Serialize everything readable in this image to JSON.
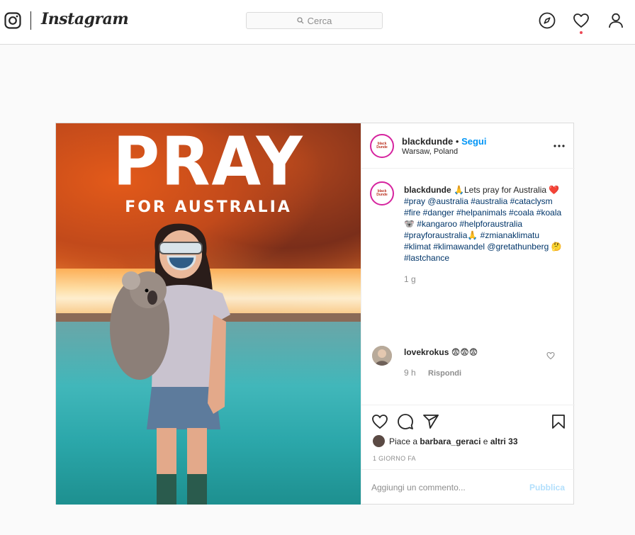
{
  "nav": {
    "brand": "Instagram",
    "search_placeholder": "Cerca",
    "icons": [
      "instagram-logo-icon",
      "search-icon",
      "explore-compass-icon",
      "activity-heart-icon",
      "profile-icon"
    ]
  },
  "post": {
    "image": {
      "headline": "PRAY",
      "subheadline": "FOR AUSTRALIA"
    },
    "header": {
      "username": "blackdunde",
      "separator": "•",
      "follow": "Segui",
      "location": "Warsaw, Poland",
      "avatar_text": "black Dunde"
    },
    "caption": {
      "username": "blackdunde",
      "emoji_pray": "🙏",
      "text_start": "Lets pray for Australia",
      "emoji_heart": "❤️",
      "tags": "#pray @australia #australia #cataclysm #fire #danger #helpanimals #coala #koala🐨 #kangaroo #helpforaustralia #prayforaustralia🙏 #zmianaklimatu #klimat #klimawandel @gretathunberg 🤔#lastchance",
      "time": "1 g"
    },
    "comment": {
      "username": "lovekrokus",
      "text": "😨😨😨",
      "time": "9 h",
      "reply": "Rispondi"
    },
    "likes": {
      "prefix": "Piace a ",
      "user": "barbara_geraci",
      "middle": " e ",
      "others": "altri 33"
    },
    "date": "1 GIORNO FA",
    "add_comment_placeholder": "Aggiungi un commento...",
    "publish": "Pubblica"
  },
  "colors": {
    "link": "#0095f6",
    "hashtag": "#003569",
    "border": "#dbdbdb",
    "notification": "#ed4956"
  }
}
